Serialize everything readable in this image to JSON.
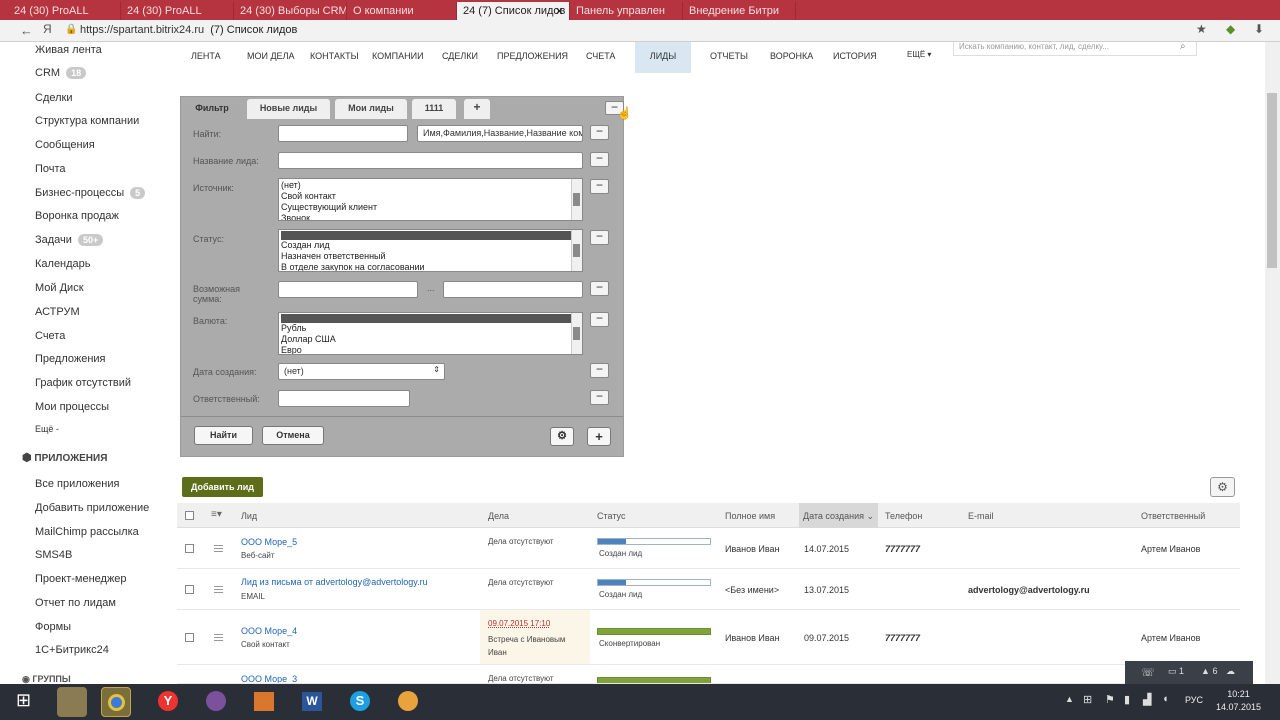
{
  "browser": {
    "tabs": [
      {
        "label": "24 (30) ProALL"
      },
      {
        "label": "24 (30) ProALL"
      },
      {
        "label": "24 (30) Выборы CRM |"
      },
      {
        "label": "О компании"
      },
      {
        "label": "24 (7) Список лидов"
      },
      {
        "label": "Панель управлен"
      },
      {
        "label": "Внедрение Битри"
      }
    ],
    "url": "https://spartant.bitrix24.ru",
    "page_title": "(7) Список лидов"
  },
  "left_menu": {
    "items": [
      {
        "label": "Живая лента"
      },
      {
        "label": "CRM",
        "count": "18"
      },
      {
        "label": "Сделки"
      },
      {
        "label": "Структура компании"
      },
      {
        "label": "Сообщения"
      },
      {
        "label": "Почта"
      },
      {
        "label": "Бизнес-процессы",
        "count": "5"
      },
      {
        "label": "Воронка продаж"
      },
      {
        "label": "Задачи",
        "count": "50+"
      },
      {
        "label": "Календарь"
      },
      {
        "label": "Мой Диск"
      },
      {
        "label": "АСТРУМ"
      },
      {
        "label": "Счета"
      },
      {
        "label": "Предложения"
      },
      {
        "label": "График отсутствий"
      },
      {
        "label": "Мои процессы"
      },
      {
        "label": "Ещё -"
      }
    ],
    "apps_header": "ПРИЛОЖЕНИЯ",
    "apps": [
      {
        "label": "Все приложения"
      },
      {
        "label": "Добавить приложение"
      },
      {
        "label": "MailChimp рассылка"
      },
      {
        "label": "SMS4B"
      },
      {
        "label": "Проект-менеджер"
      },
      {
        "label": "Отчет по лидам"
      },
      {
        "label": "Формы"
      },
      {
        "label": "1С+Битрикс24"
      }
    ],
    "groups_label": "ГРУППЫ"
  },
  "top_nav": {
    "items": [
      {
        "label": "ЛЕНТА"
      },
      {
        "label": "МОИ ДЕЛА"
      },
      {
        "label": "КОНТАКТЫ"
      },
      {
        "label": "КОМПАНИИ"
      },
      {
        "label": "СДЕЛКИ"
      },
      {
        "label": "ПРЕДЛОЖЕНИЯ"
      },
      {
        "label": "СЧЕТА"
      },
      {
        "label": "ЛИДЫ"
      },
      {
        "label": "ОТЧЕТЫ"
      },
      {
        "label": "ВОРОНКА"
      },
      {
        "label": "ИСТОРИЯ"
      },
      {
        "label": "ЕЩЁ ▾"
      }
    ],
    "search_placeholder": "Искать компанию, контакт, лид, сделку..."
  },
  "filter": {
    "tabs": [
      {
        "label": "Фильтр"
      },
      {
        "label": "Новые лиды"
      },
      {
        "label": "Мои лиды"
      },
      {
        "label": "1111"
      },
      {
        "label": "+"
      }
    ],
    "find_label": "Найти:",
    "find_value": "",
    "find_fields_value": "Имя,Фамилия,Название,Название компании",
    "lead_name_label": "Название лида:",
    "source_label": "Источник:",
    "source_options": [
      "(нет)",
      "Свой контакт",
      "Существующий клиент",
      "Звонок"
    ],
    "status_label": "Статус:",
    "status_options": [
      "",
      "Создан лид",
      "Назначен ответственный",
      "В отделе закупок на согласовании"
    ],
    "amount_label": "Возможная сумма:",
    "amount_sep": "...",
    "currency_label": "Валюта:",
    "currency_options": [
      "",
      "Рубль",
      "Доллар США",
      "Евро"
    ],
    "created_label": "Дата создания:",
    "created_value": "(нет)",
    "responsible_label": "Ответственный:",
    "find_button": "Найти",
    "cancel_button": "Отмена"
  },
  "grid": {
    "add_button": "Добавить лид",
    "headers": {
      "lead": "Лид",
      "tasks": "Дела",
      "status": "Статус",
      "fullname": "Полное имя",
      "created": "Дата создания",
      "phone": "Телефон",
      "email": "E-mail",
      "responsible": "Ответственный"
    },
    "rows": [
      {
        "title": "ООО Море_5",
        "source": "Веб-сайт",
        "tasks": "Дела отсутствуют",
        "task_date": "",
        "task_text": "",
        "status": "Создан лид",
        "progress": 0.25,
        "done": false,
        "fullname": "Иванов Иван",
        "date": "14.07.2015",
        "phone": "7777777",
        "email": "",
        "responsible": "Артем Иванов"
      },
      {
        "title": "Лид из письма от advertology@advertology.ru",
        "source": "EMAIL",
        "tasks": "Дела отсутствуют",
        "task_date": "",
        "task_text": "",
        "status": "Создан лид",
        "progress": 0.25,
        "done": false,
        "fullname": "<Без имени>",
        "date": "13.07.2015",
        "phone": "",
        "email": "advertology@advertology.ru",
        "responsible": ""
      },
      {
        "title": "ООО Море_4",
        "source": "Свой контакт",
        "tasks": "",
        "task_date": "09.07.2015 17:10",
        "task_text": "Встреча с Ивановым Иван",
        "status": "Сконвертирован",
        "progress": 1,
        "done": true,
        "fullname": "Иванов Иван",
        "date": "09.07.2015",
        "phone": "7777777",
        "email": "",
        "responsible": "Артем Иванов"
      },
      {
        "title": "ООО Море_3",
        "source": "",
        "tasks": "Дела отсутствуют",
        "task_date": "",
        "task_text": "",
        "status": "",
        "progress": 1,
        "done": true,
        "fullname": "",
        "date": "",
        "phone": "",
        "email": "",
        "responsible": ""
      }
    ]
  },
  "notifications": {
    "messages": "1",
    "alerts": "6"
  },
  "taskbar": {
    "lang": "РУС",
    "time": "10:21",
    "date": "14.07.2015"
  }
}
